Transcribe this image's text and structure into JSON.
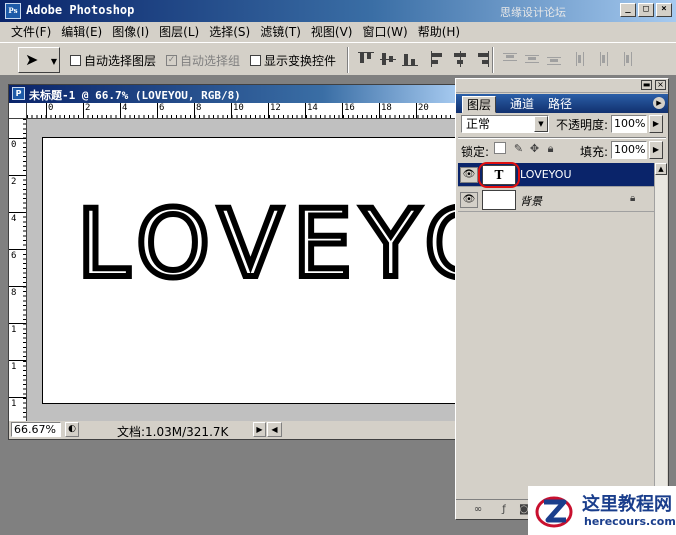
{
  "app": {
    "title": "Adobe Photoshop",
    "icon_letter": "Ps",
    "watermark": "思缘设计论坛",
    "window_buttons": [
      "_",
      "□",
      "×"
    ]
  },
  "menu": [
    "文件(F)",
    "编辑(E)",
    "图像(I)",
    "图层(L)",
    "选择(S)",
    "滤镜(T)",
    "视图(V)",
    "窗口(W)",
    "帮助(H)"
  ],
  "options_bar": {
    "tool_icon": "move-tool-icon",
    "auto_select_layer": {
      "label": "自动选择图层",
      "checked": false,
      "enabled": true
    },
    "auto_select_group": {
      "label": "自动选择组",
      "checked": true,
      "enabled": false
    },
    "show_transform": {
      "label": "显示变换控件",
      "checked": false,
      "enabled": true
    }
  },
  "document": {
    "title": "未标题-1 @ 66.7% (LOVEYOU, RGB/8)",
    "canvas_text": "LOVEYOU",
    "h_ruler_labels": [
      "0",
      "2",
      "4",
      "6",
      "8",
      "10",
      "12",
      "14",
      "16",
      "18",
      "20"
    ],
    "v_ruler_labels": [
      "0",
      "2",
      "4",
      "6",
      "8",
      "1",
      "1",
      "1"
    ],
    "zoom": "66.67%",
    "doc_size": "文档:1.03M/321.7K"
  },
  "layers_palette": {
    "tabs": [
      "图层",
      "通道",
      "路径"
    ],
    "active_tab": "图层",
    "blend_mode": "正常",
    "opacity_label": "不透明度:",
    "opacity": "100%",
    "lock_label": "锁定:",
    "fill_label": "填充:",
    "fill": "100%",
    "layers": [
      {
        "name": "LOVEYOU",
        "thumb": "T",
        "selected": true,
        "locked": false
      },
      {
        "name": "背景",
        "thumb": "",
        "selected": false,
        "locked": true
      }
    ]
  },
  "logo": {
    "cn": "这里教程网",
    "en": "herecours.com"
  },
  "colors": {
    "title_blue": "#0a246a",
    "chrome": "#d4d0c8",
    "workspace": "#808080",
    "highlight_red": "#e01010",
    "logo_blue": "#1a3e8c"
  }
}
